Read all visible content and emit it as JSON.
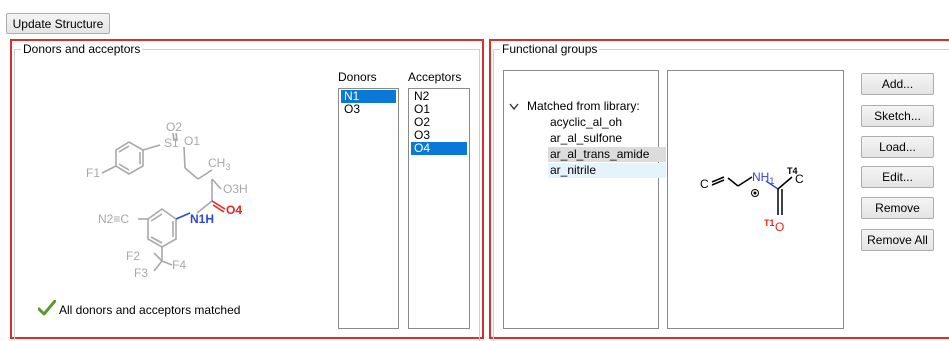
{
  "toolbar": {
    "update_label": "Update Structure"
  },
  "donors_panel": {
    "title": "Donors and acceptors",
    "donors_header": "Donors",
    "acceptors_header": "Acceptors",
    "donors": [
      {
        "label": "N1",
        "selected": true
      },
      {
        "label": "O3",
        "selected": false
      }
    ],
    "acceptors": [
      {
        "label": "N2",
        "selected": false
      },
      {
        "label": "O1",
        "selected": false
      },
      {
        "label": "O2",
        "selected": false
      },
      {
        "label": "O3",
        "selected": false
      },
      {
        "label": "O4",
        "selected": true
      }
    ],
    "status": "All donors and acceptors matched",
    "molecule": {
      "o2": "O2",
      "s1": "S1",
      "o1": "O1",
      "f1": "F1",
      "ch": "CH",
      "ch_sub": "3",
      "oh": "O3H",
      "n2c": "N2≡C",
      "n1h": "N1H",
      "o4": "O4",
      "f2": "F2",
      "f3": "F3",
      "f4": "F4"
    }
  },
  "functional_panel": {
    "title": "Functional groups",
    "tree_root": "Matched from library:",
    "tree_items": [
      {
        "label": "acyclic_al_oh",
        "state": "normal"
      },
      {
        "label": "ar_al_sulfone",
        "state": "normal"
      },
      {
        "label": "ar_al_trans_amide",
        "state": "selected"
      },
      {
        "label": "ar_nitrile",
        "state": "hover"
      }
    ],
    "buttons": {
      "add": "Add...",
      "sketch": "Sketch...",
      "load": "Load...",
      "edit": "Edit...",
      "remove": "Remove",
      "remove_all": "Remove All"
    },
    "fragment": {
      "c_left": "C",
      "nh": "NH",
      "nh_sub": "1",
      "t4": "T4",
      "c_right": "C",
      "t1": "T1",
      "o": "O"
    }
  },
  "colors": {
    "border_red": "#d9302f",
    "selection_blue": "#0a78d7",
    "hetero_red": "#e8231f",
    "hetero_blue": "#3146e0",
    "check_green": "#5a9a2a"
  }
}
